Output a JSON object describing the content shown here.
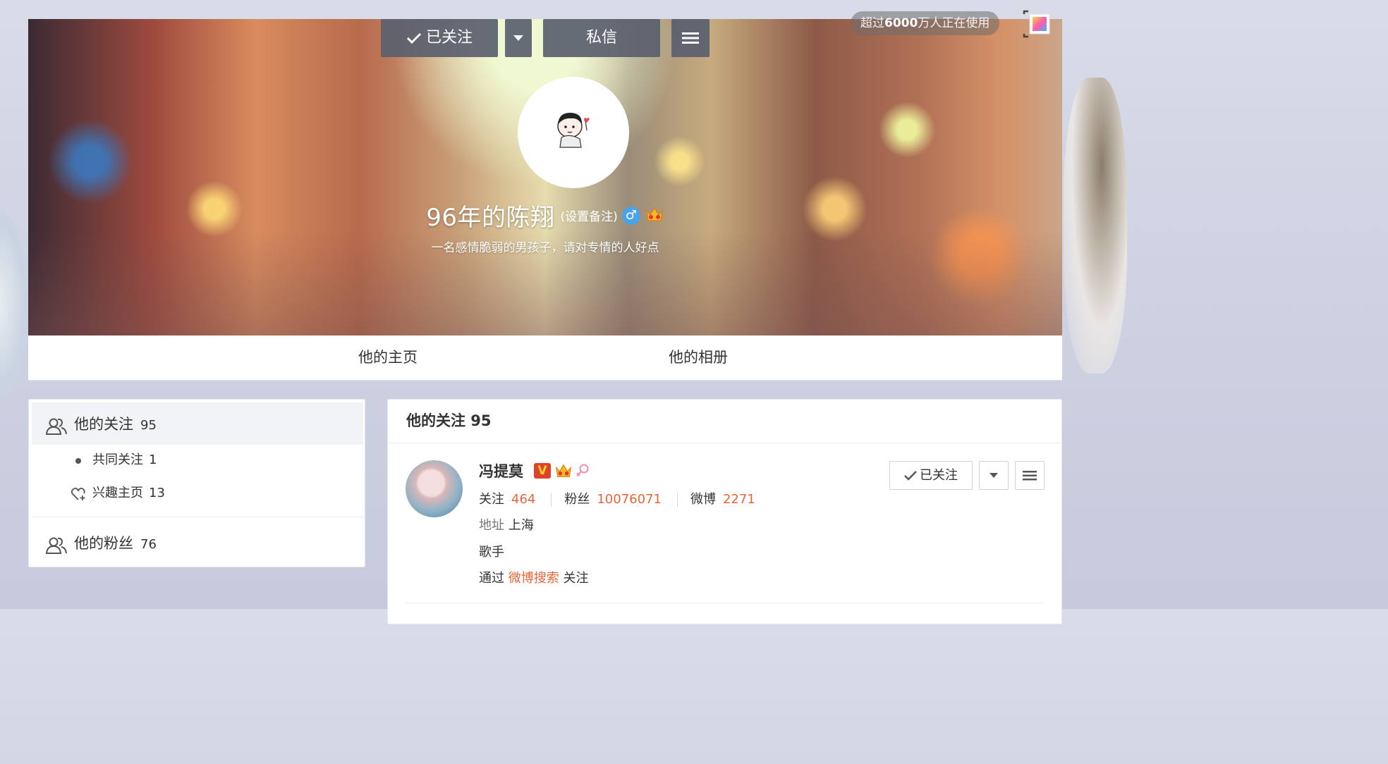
{
  "topbar": {
    "users_prefix": "超过",
    "users_number": "6000",
    "users_suffix": "万人正在使用"
  },
  "profile": {
    "name": "96年的陈翔",
    "remark": "(设置备注)",
    "gender_symbol": "♂",
    "bio": "一名感情脆弱的男孩子，请对专情的人好点",
    "follow_label": "已关注",
    "message_label": "私信"
  },
  "tabs": [
    "他的主页",
    "他的相册"
  ],
  "sidebar": {
    "following": {
      "label": "他的关注",
      "count": "95"
    },
    "mutual": {
      "label": "共同关注",
      "count": "1"
    },
    "interest": {
      "label": "兴趣主页",
      "count": "13"
    },
    "fans": {
      "label": "他的粉丝",
      "count": "76"
    }
  },
  "main": {
    "title": "他的关注 95",
    "user": {
      "name": "冯提莫",
      "v_badge": "V",
      "following_label": "关注",
      "following_count": "464",
      "fans_label": "粉丝",
      "fans_count": "10076071",
      "weibo_label": "微博",
      "weibo_count": "2271",
      "location_label": "地址",
      "location": "上海",
      "description": "歌手",
      "via_prefix": "通过",
      "via_source": "微博搜索",
      "via_suffix": "关注",
      "follow_label": "已关注"
    }
  },
  "colors": {
    "accent": "#e8653a",
    "dark_button": "#5a606e",
    "verified": "#e0412b",
    "male": "#4aa3e8"
  }
}
